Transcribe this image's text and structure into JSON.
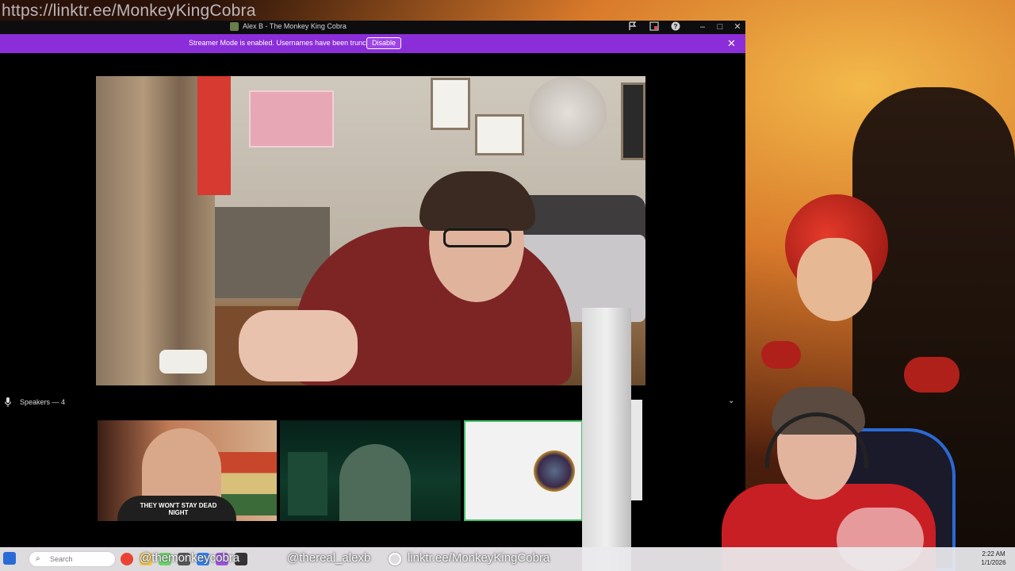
{
  "overlay": {
    "top_link": "https://linktr.ee/MonkeyKingCobra",
    "bottom_handles": "@themonkeycobra",
    "bottom_handle2": "@thereal_alexb",
    "bottom_link": "linktr.ee/MonkeyKingCobra"
  },
  "window": {
    "title": "Alex B - The Monkey King Cobra",
    "controls": {
      "flag_icon": "flag-icon",
      "popout_icon": "popout-icon",
      "help_icon": "help-icon",
      "minimize": "–",
      "maximize": "□",
      "close": "✕"
    }
  },
  "banner": {
    "text": "Streamer Mode is enabled. Usernames have been truncated.",
    "button_label": "Disable",
    "close": "✕",
    "color": "#8b2dd8"
  },
  "speakers": {
    "label": "Speakers — 4",
    "collapse": "⌄"
  },
  "tiles": [
    {
      "name": "speaker-1",
      "shirt_text": "THEY WON'T STAY DEAD NIGHT"
    },
    {
      "name": "speaker-2"
    },
    {
      "name": "speaker-3-avatar",
      "highlighted": true,
      "highlight_color": "#3fc26a"
    }
  ],
  "taskbar": {
    "search_placeholder": "Search",
    "clock_time": "2:22 AM",
    "clock_date": "1/1/2026"
  }
}
